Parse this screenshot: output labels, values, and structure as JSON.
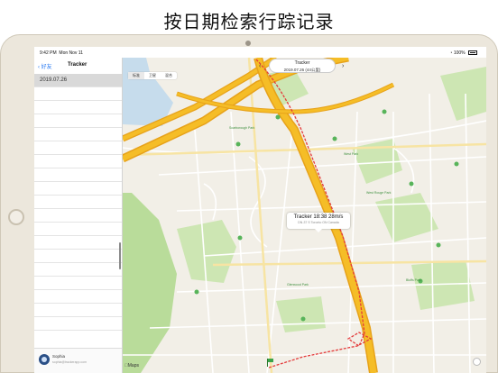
{
  "caption": "按日期检索行踪记录",
  "status_bar": {
    "time": "9:42 PM",
    "date": "Mon Nov 11",
    "battery": "100%"
  },
  "sidebar": {
    "back_label": "好友",
    "title": "Tracker",
    "items": [
      {
        "label": "2019.07.26"
      }
    ],
    "empty_rows": 18,
    "footer": {
      "name": "Sophia",
      "email": "sophia@trackerapp.com"
    }
  },
  "map": {
    "title": "Tracker",
    "subtitle": "2019.07.26 (44公里)",
    "prev_label": "‹",
    "next_label": "›",
    "map_types": [
      "标准",
      "卫星",
      "混合"
    ],
    "selected_map_type": "标准",
    "callout": {
      "title": "Tracker 18:38 28m/s",
      "address": "DN-37 S Toronto ON Canada"
    },
    "attribution": "Maps",
    "labels": [
      "Scarborough Park",
      "West Park",
      "West Rouge Park",
      "Glenwood Park",
      "Bluffs Park"
    ],
    "colors": {
      "land": "#f2efe7",
      "highway": "#f5bd27",
      "highway_edge": "#e7a21a",
      "park": "#b9dc9a",
      "route": "#e43b3b",
      "water": "#c6dcec",
      "accent": "#2b7bf2"
    },
    "icons": [
      "flag-icon",
      "compass-icon",
      "location-pin-icon"
    ]
  }
}
